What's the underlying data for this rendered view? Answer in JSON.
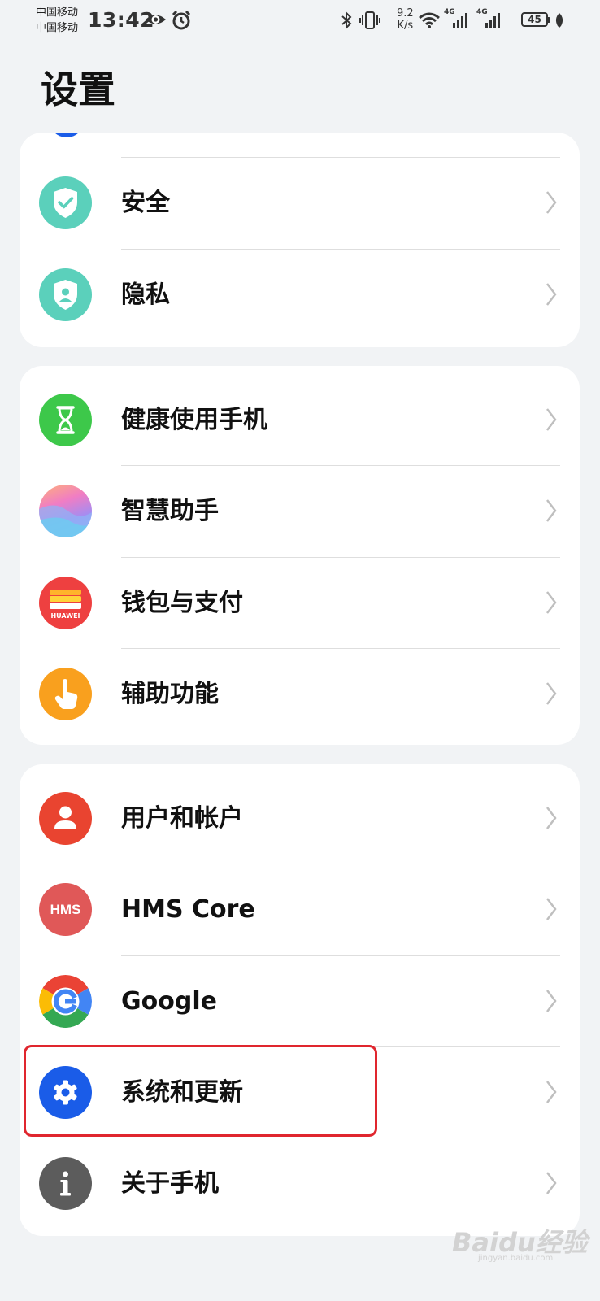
{
  "status_bar": {
    "carrier_1": "中国移动",
    "carrier_2": "中国移动",
    "time": "13:42",
    "net_speed_value": "9.2",
    "net_speed_unit": "K/s",
    "signal_1_label": "4G",
    "signal_2_label": "4G",
    "battery": "45",
    "icons": [
      "eye-icon",
      "alarm-icon",
      "bluetooth-icon",
      "vibrate-icon",
      "wifi-icon",
      "signal-icon",
      "signal-icon",
      "battery-icon",
      "leaf-icon"
    ]
  },
  "page": {
    "title": "设置"
  },
  "groups": [
    {
      "items": [
        {
          "label": "安全",
          "icon": "shield-check-icon",
          "color": "#5bd0bb"
        },
        {
          "label": "隐私",
          "icon": "privacy-shield-icon",
          "color": "#5bd0bb"
        }
      ]
    },
    {
      "items": [
        {
          "label": "健康使用手机",
          "icon": "hourglass-icon",
          "color": "#3dc84a"
        },
        {
          "label": "智慧助手",
          "icon": "smart-assistant-icon",
          "color": "#b58ff0"
        },
        {
          "label": "钱包与支付",
          "icon": "huawei-wallet-icon",
          "color": "#ee4040",
          "icon_text": "HUAWEI"
        },
        {
          "label": "辅助功能",
          "icon": "hand-pointer-icon",
          "color": "#f9a01e"
        }
      ]
    },
    {
      "items": [
        {
          "label": "用户和帐户",
          "icon": "user-icon",
          "color": "#e94430"
        },
        {
          "label": "HMS Core",
          "icon": "hms-icon",
          "color": "#e05858",
          "icon_text": "HMS"
        },
        {
          "label": "Google",
          "icon": "google-icon",
          "color": "#4285f4"
        },
        {
          "label": "系统和更新",
          "icon": "gear-icon",
          "color": "#1a5ce8"
        },
        {
          "label": "关于手机",
          "icon": "info-icon",
          "color": "#5c5c5c"
        }
      ]
    }
  ],
  "watermark": {
    "text": "Baidu经验",
    "sub": "jingyan.baidu.com"
  }
}
